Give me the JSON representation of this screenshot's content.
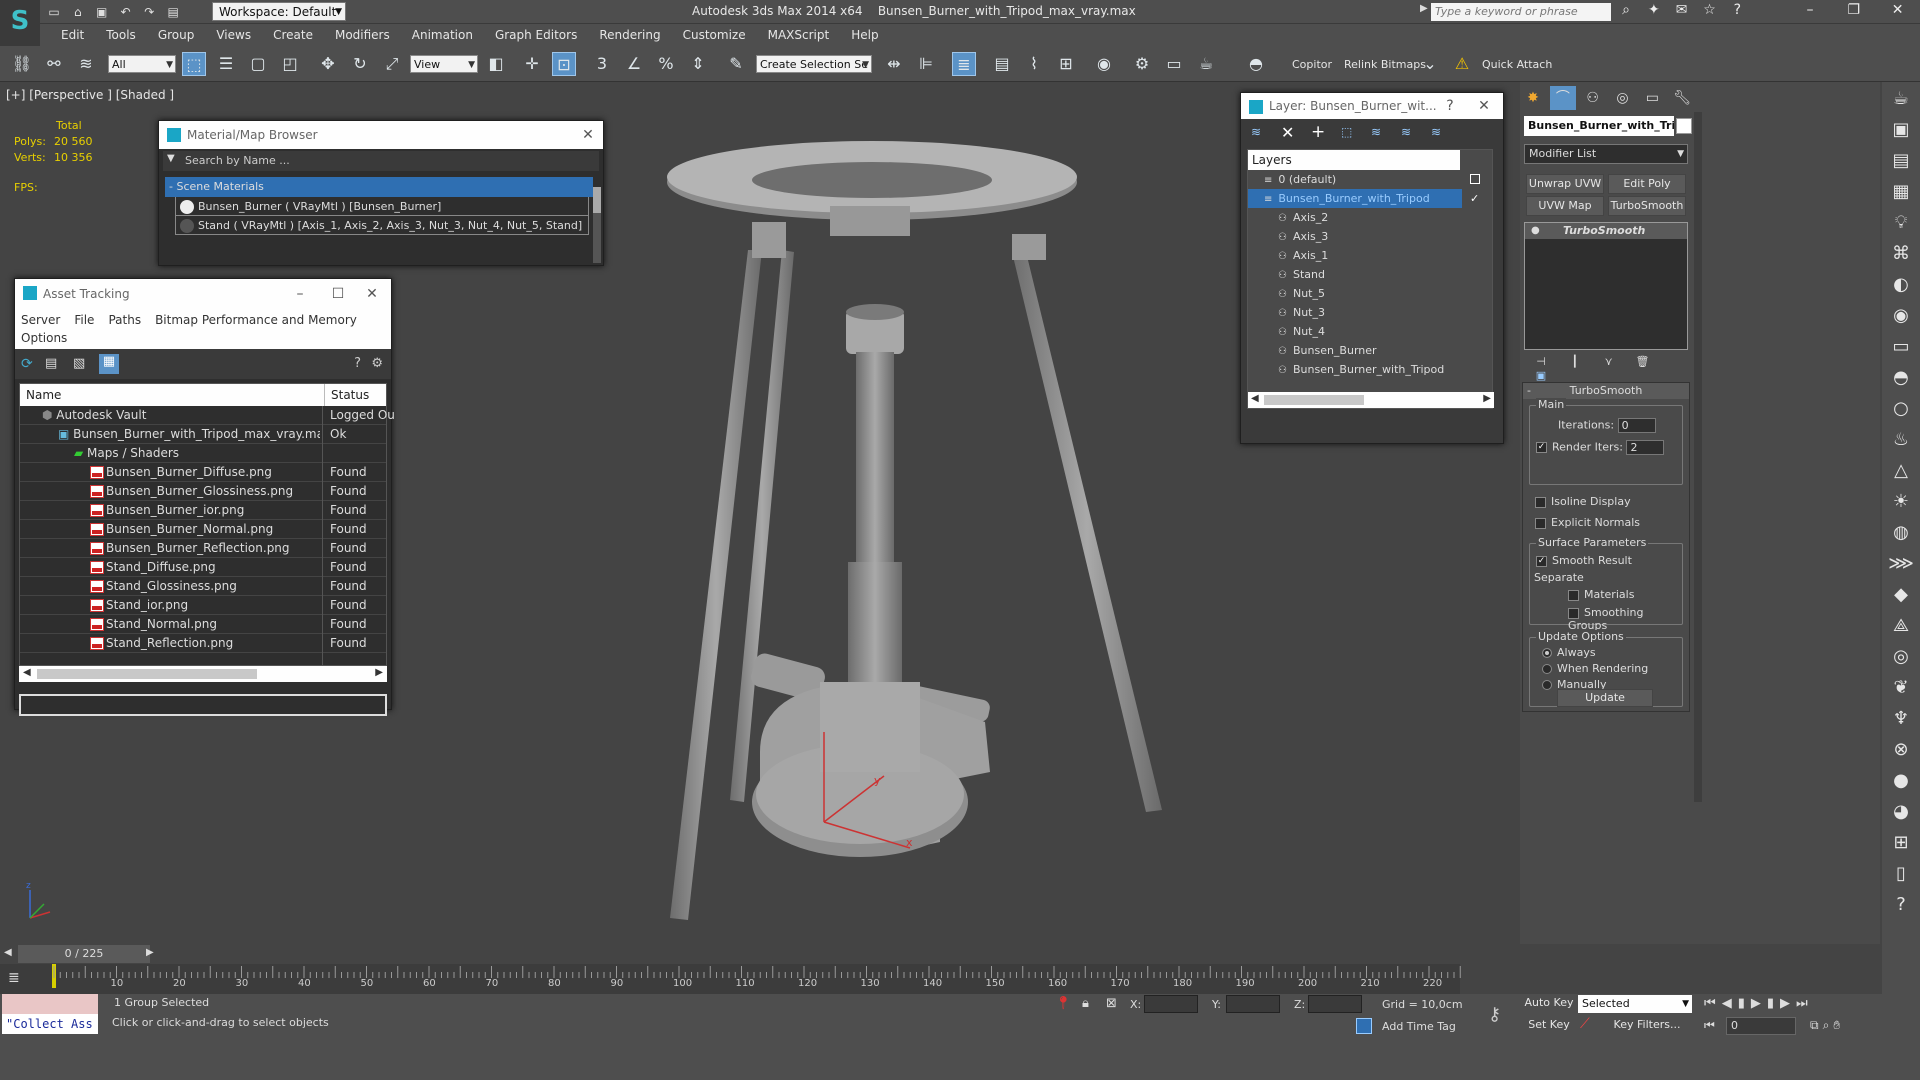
{
  "titlebar": {
    "workspace": "Workspace: Default",
    "app": "Autodesk 3ds Max  2014 x64",
    "file": "Bunsen_Burner_with_Tripod_max_vray.max",
    "search_placeholder": "Type a keyword or phrase"
  },
  "menus": [
    "Edit",
    "Tools",
    "Group",
    "Views",
    "Create",
    "Modifiers",
    "Animation",
    "Graph Editors",
    "Rendering",
    "Customize",
    "MAXScript",
    "Help"
  ],
  "toolbar": {
    "filter": "All",
    "refcoord": "View",
    "selection_set": "Create Selection Se",
    "copitor": "Copitor",
    "relink": "Relink Bitmaps",
    "quick_attach": "Quick Attach"
  },
  "viewport": {
    "label": "[+] [Perspective ] [Shaded ]",
    "total": "Total",
    "polys_label": "Polys:",
    "polys": "20 560",
    "verts_label": "Verts:",
    "verts": "10 356",
    "fps_label": "FPS:"
  },
  "material_browser": {
    "title": "Material/Map Browser",
    "search": "Search by Name ...",
    "group": "- Scene Materials",
    "items": [
      "Bunsen_Burner  ( VRayMtl )  [Bunsen_Burner]",
      "Stand  ( VRayMtl )  [Axis_1, Axis_2, Axis_3, Nut_3, Nut_4, Nut_5, Stand]"
    ]
  },
  "asset_tracking": {
    "title": "Asset Tracking",
    "menus": [
      "Server",
      "File",
      "Paths",
      "Bitmap Performance and Memory"
    ],
    "options": "Options",
    "col_name": "Name",
    "col_status": "Status",
    "rows": [
      {
        "name": "Autodesk Vault",
        "status": "Logged Ou",
        "indent": 1
      },
      {
        "name": "Bunsen_Burner_with_Tripod_max_vray.max",
        "status": "Ok",
        "indent": 2
      },
      {
        "name": "Maps / Shaders",
        "status": "",
        "indent": 3
      },
      {
        "name": "Bunsen_Burner_Diffuse.png",
        "status": "Found",
        "indent": 4
      },
      {
        "name": "Bunsen_Burner_Glossiness.png",
        "status": "Found",
        "indent": 4
      },
      {
        "name": "Bunsen_Burner_ior.png",
        "status": "Found",
        "indent": 4
      },
      {
        "name": "Bunsen_Burner_Normal.png",
        "status": "Found",
        "indent": 4
      },
      {
        "name": "Bunsen_Burner_Reflection.png",
        "status": "Found",
        "indent": 4
      },
      {
        "name": "Stand_Diffuse.png",
        "status": "Found",
        "indent": 4
      },
      {
        "name": "Stand_Glossiness.png",
        "status": "Found",
        "indent": 4
      },
      {
        "name": "Stand_ior.png",
        "status": "Found",
        "indent": 4
      },
      {
        "name": "Stand_Normal.png",
        "status": "Found",
        "indent": 4
      },
      {
        "name": "Stand_Reflection.png",
        "status": "Found",
        "indent": 4
      }
    ]
  },
  "layers": {
    "title": "Layer: Bunsen_Burner_wit...",
    "help": "?",
    "header": "Layers",
    "items": [
      {
        "name": "0 (default)",
        "level": 1
      },
      {
        "name": "Bunsen_Burner_with_Tripod",
        "level": 1,
        "selected": true
      },
      {
        "name": "Axis_2",
        "level": 2
      },
      {
        "name": "Axis_3",
        "level": 2
      },
      {
        "name": "Axis_1",
        "level": 2
      },
      {
        "name": "Stand",
        "level": 2
      },
      {
        "name": "Nut_5",
        "level": 2
      },
      {
        "name": "Nut_3",
        "level": 2
      },
      {
        "name": "Nut_4",
        "level": 2
      },
      {
        "name": "Bunsen_Burner",
        "level": 2
      },
      {
        "name": "Bunsen_Burner_with_Tripod",
        "level": 2
      }
    ]
  },
  "command_panel": {
    "object_name": "Bunsen_Burner_with_Trip",
    "modifier_list": "Modifier List",
    "buttons": [
      "Unwrap UVW",
      "Edit Poly",
      "UVW Map",
      "TurboSmooth"
    ],
    "stack_item": "TurboSmooth",
    "rollout": "TurboSmooth",
    "main": "Main",
    "iterations_label": "Iterations:",
    "iterations": "0",
    "render_iters_label": "Render Iters:",
    "render_iters": "2",
    "isoline": "Isoline Display",
    "explicit": "Explicit Normals",
    "surface": "Surface Parameters",
    "smooth_result": "Smooth Result",
    "separate": "Separate",
    "materials": "Materials",
    "smoothing_groups": "Smoothing Groups",
    "update_options": "Update Options",
    "always": "Always",
    "when_rendering": "When Rendering",
    "manually": "Manually",
    "update": "Update"
  },
  "timeline": {
    "frame": "0 / 225",
    "ticks": [
      "10",
      "20",
      "30",
      "40",
      "50",
      "60",
      "70",
      "80",
      "90",
      "100",
      "110",
      "120",
      "130",
      "140",
      "150",
      "160",
      "170",
      "180",
      "190",
      "200",
      "210",
      "220"
    ]
  },
  "status": {
    "script": "\"Collect Ass",
    "selection": "1 Group Selected",
    "prompt": "Click or click-and-drag to select objects",
    "x": "X:",
    "y": "Y:",
    "z": "Z:",
    "grid": "Grid = 10,0cm",
    "add_time_tag": "Add Time Tag",
    "auto_key": "Auto Key",
    "set_key": "Set Key",
    "selected": "Selected",
    "key_filters": "Key Filters...",
    "frame_field": "0"
  }
}
